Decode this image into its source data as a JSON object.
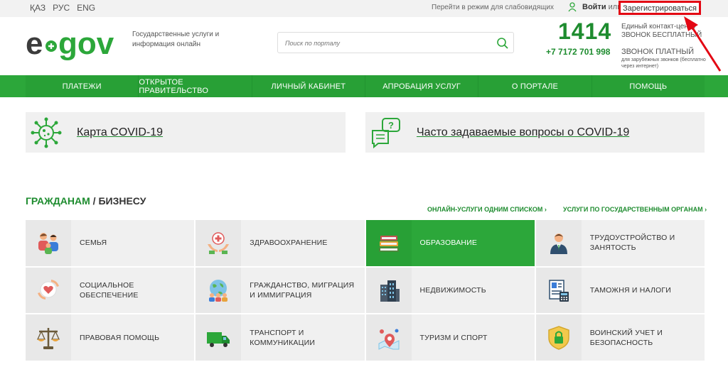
{
  "topbar": {
    "languages": [
      "ҚАЗ",
      "РУС",
      "ENG"
    ],
    "low_vision": "Перейти в режим для слабовидящих",
    "login": "Войти",
    "or": "или",
    "register": "Зарегистрироваться"
  },
  "header": {
    "slogan": "Государственные услуги и информация онлайн",
    "search_placeholder": "Поиск по порталу",
    "contact_number": "1414",
    "contact_label": "Единый контакт-центр ЗВОНОК БЕСПЛАТНЫЙ",
    "phone": "+7 7172 701 998",
    "paid_label": "ЗВОНОК ПЛАТНЫЙ",
    "foreign_note": "для зарубежных звонков (бесплатно через интернет)"
  },
  "nav": {
    "items": [
      "ПЛАТЕЖИ",
      "ОТКРЫТОЕ ПРАВИТЕЛЬСТВО",
      "ЛИЧНЫЙ КАБИНЕТ",
      "АПРОБАЦИЯ УСЛУГ",
      "О ПОРТАЛЕ",
      "ПОМОЩЬ"
    ]
  },
  "covid": {
    "map_label": "Карта COVID-19",
    "faq_label": "Часто задаваемые вопросы о COVID-19"
  },
  "section": {
    "title_citizens": "ГРАЖДАНАМ",
    "separator": "/",
    "title_business": "БИЗНЕСУ",
    "link_online": "ОНЛАЙН-УСЛУГИ ОДНИМ СПИСКОМ ›",
    "link_agencies": "УСЛУГИ ПО ГОСУДАРСТВЕННЫМ ОРГАНАМ ›"
  },
  "tiles": [
    {
      "label": "СЕМЬЯ",
      "icon": "family-icon"
    },
    {
      "label": "ЗДРАВООХРАНЕНИЕ",
      "icon": "healthcare-icon"
    },
    {
      "label": "ОБРАЗОВАНИЕ",
      "icon": "books-icon",
      "active": true
    },
    {
      "label": "ТРУДОУСТРОЙСТВО И ЗАНЯТОСТЬ",
      "icon": "worker-icon"
    },
    {
      "label": "СОЦИАЛЬНОЕ ОБЕСПЕЧЕНИЕ",
      "icon": "social-care-icon"
    },
    {
      "label": "ГРАЖДАНСТВО, МИГРАЦИЯ И ИММИГРАЦИЯ",
      "icon": "globe-people-icon"
    },
    {
      "label": "НЕДВИЖИМОСТЬ",
      "icon": "buildings-icon"
    },
    {
      "label": "ТАМОЖНЯ И НАЛОГИ",
      "icon": "customs-icon"
    },
    {
      "label": "ПРАВОВАЯ ПОМОЩЬ",
      "icon": "scales-icon"
    },
    {
      "label": "ТРАНСПОРТ И КОММУНИКАЦИИ",
      "icon": "truck-icon"
    },
    {
      "label": "ТУРИЗМ И СПОРТ",
      "icon": "map-pin-icon"
    },
    {
      "label": "ВОИНСКИЙ УЧЕТ И БЕЗОПАСНОСТЬ",
      "icon": "shield-lock-icon"
    }
  ],
  "colors": {
    "brand_green": "#2ca73a",
    "dark_green": "#1e8c2f",
    "highlight_red": "#e30613"
  }
}
